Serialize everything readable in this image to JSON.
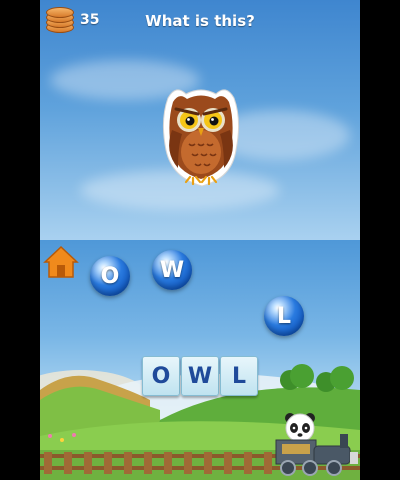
{
  "header": {
    "coins": "35",
    "question": "What is this?"
  },
  "picture": {
    "subject": "owl",
    "icon": "owl-icon"
  },
  "letter_bubbles": [
    "O",
    "W",
    "L"
  ],
  "answer_tiles": [
    "O",
    "W",
    "L"
  ],
  "controls": {
    "home": "home-icon"
  },
  "colors": {
    "sky_top": "#3f86cf",
    "bubble": "#2a7be0",
    "tile_text": "#1f4a9a",
    "hill": "#5fae3c",
    "train": "#4a5866"
  }
}
